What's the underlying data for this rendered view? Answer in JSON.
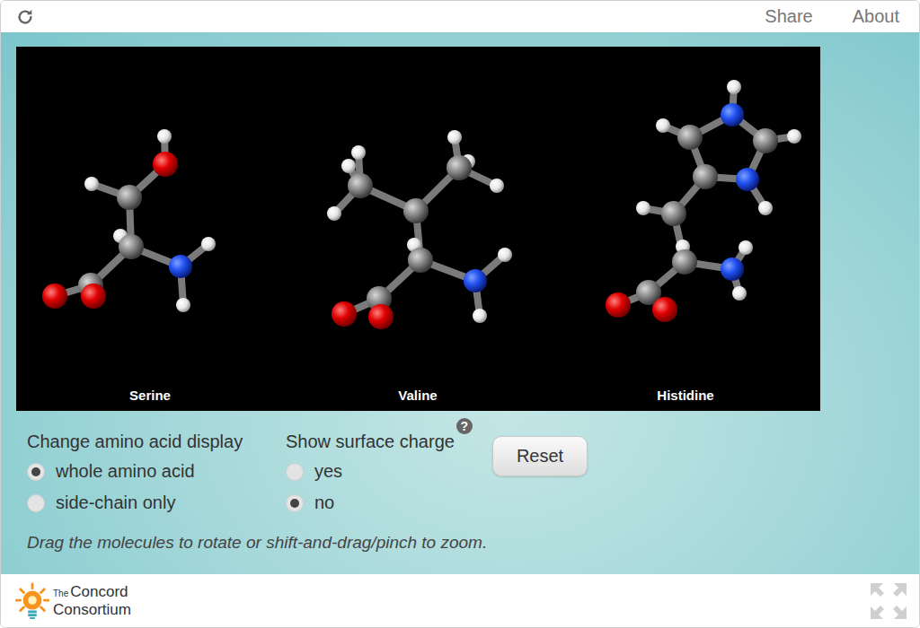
{
  "header_links": [
    "Share",
    "About"
  ],
  "molecules": [
    {
      "name": "Serine"
    },
    {
      "name": "Valine"
    },
    {
      "name": "Histidine"
    }
  ],
  "controls": [
    {
      "label": "Change amino acid display",
      "help": "",
      "options": [
        {
          "label": "whole amino acid",
          "selected": true
        },
        {
          "label": "side-chain only",
          "selected": false
        }
      ]
    },
    {
      "label": "Show surface charge",
      "help": "?",
      "options": [
        {
          "label": "yes",
          "selected": false
        },
        {
          "label": "no",
          "selected": true
        }
      ]
    }
  ],
  "reset_button": "Reset",
  "hint": "Drag the molecules to rotate or shift-and-drag/pinch to zoom.",
  "logo": {
    "small": "The",
    "line1": "Concord",
    "line2": "Consortium"
  }
}
